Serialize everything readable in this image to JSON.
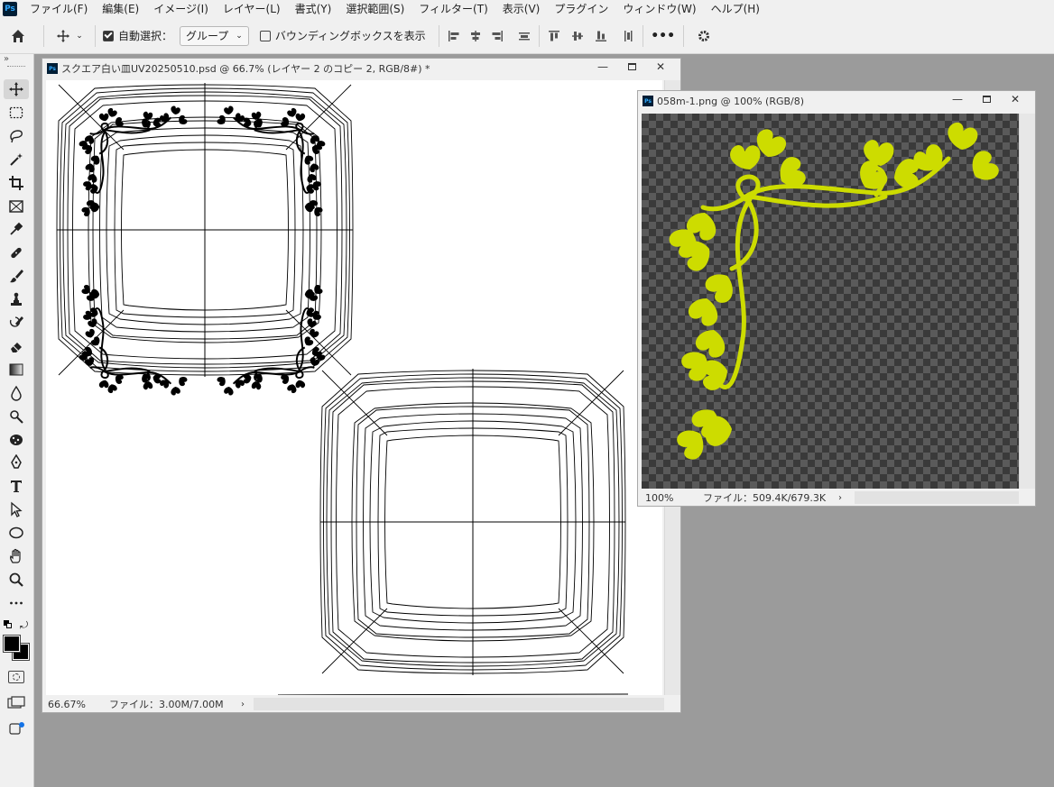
{
  "menubar": {
    "items": [
      "ファイル(F)",
      "編集(E)",
      "イメージ(I)",
      "レイヤー(L)",
      "書式(Y)",
      "選択範囲(S)",
      "フィルター(T)",
      "表示(V)",
      "プラグイン",
      "ウィンドウ(W)",
      "ヘルプ(H)"
    ]
  },
  "options": {
    "auto_select_label": "自動選択：",
    "auto_select_checked": true,
    "group_value": "グループ",
    "bounding_box_label": "バウンディングボックスを表示",
    "bounding_box_checked": false
  },
  "doc1": {
    "title": "スクエア白い皿UV20250510.psd @ 66.7% (レイヤー 2 のコピー 2, RGB/8#) *",
    "zoom": "66.67%",
    "file_info": "ファイル：3.00M/7.00M"
  },
  "doc2": {
    "title": "058m-1.png @ 100% (RGB/8)",
    "zoom": "100%",
    "file_info": "ファイル：509.4K/679.3K"
  },
  "colors": {
    "ornament": "#cddc00",
    "checker_dark": "#3a3a3a",
    "checker_light": "#5a5a5a",
    "workspace": "#9b9b9b",
    "panel": "#f0f0f0"
  },
  "tools": [
    "move-tool",
    "marquee-tool",
    "lasso-tool",
    "magic-wand-tool",
    "crop-tool",
    "frame-tool",
    "eyedropper-tool",
    "healing-tool",
    "brush-tool",
    "stamp-tool",
    "history-brush-tool",
    "eraser-tool",
    "gradient-tool",
    "blur-tool",
    "dodge-tool",
    "sponge-tool",
    "pen-tool",
    "type-tool",
    "path-select-tool",
    "shape-tool",
    "hand-tool",
    "zoom-tool",
    "more-tools"
  ]
}
